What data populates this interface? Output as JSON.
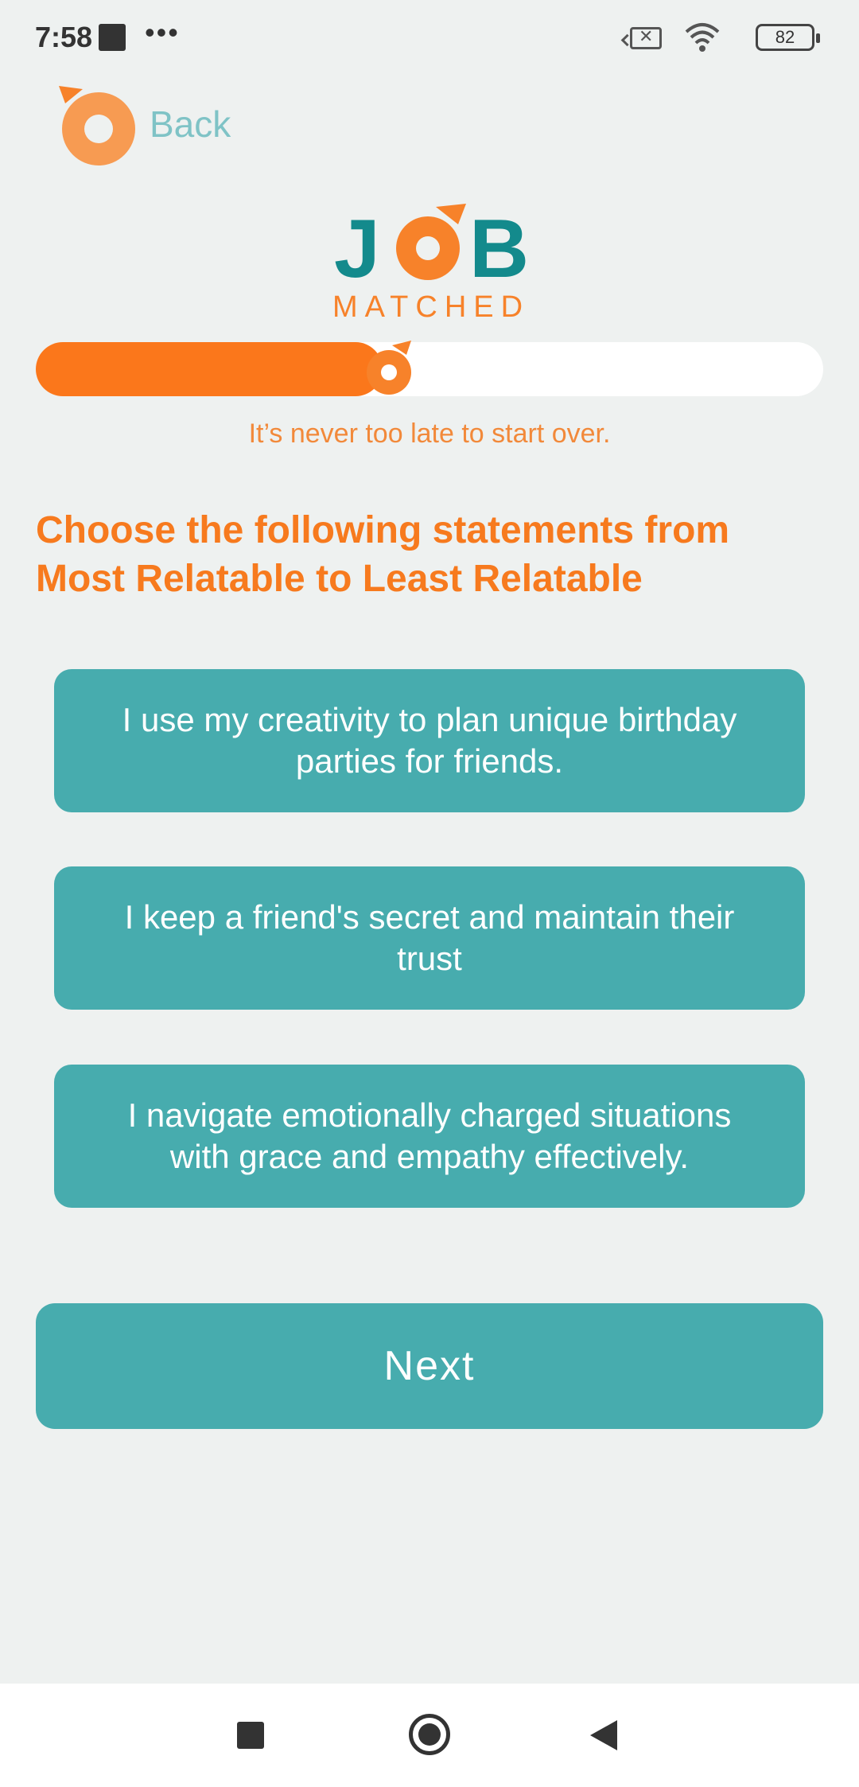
{
  "status_bar": {
    "time": "7:58",
    "app_badge": "zomato",
    "more": "•••",
    "battery": "82"
  },
  "header": {
    "back_label": "Back"
  },
  "logo": {
    "word_top": "JOB",
    "word_bottom": "MATCHED",
    "colors": {
      "teal": "#138a8c",
      "orange": "#f7822a"
    }
  },
  "progress": {
    "fraction": 0.44,
    "tagline": "It’s never too late to start over."
  },
  "question": {
    "title": "Choose the following statements from Most Relatable to Least Relatable"
  },
  "options": [
    {
      "text": "I use my creativity to plan unique birthday parties for friends."
    },
    {
      "text": "I keep a friend's secret and maintain their trust"
    },
    {
      "text": "I navigate emotionally charged situations with grace and empathy effectively."
    }
  ],
  "actions": {
    "next_label": "Next"
  },
  "colors": {
    "background": "#eef1f0",
    "accent_orange": "#fb771b",
    "accent_teal": "#47acae",
    "back_teal": "#7fc3c6"
  }
}
